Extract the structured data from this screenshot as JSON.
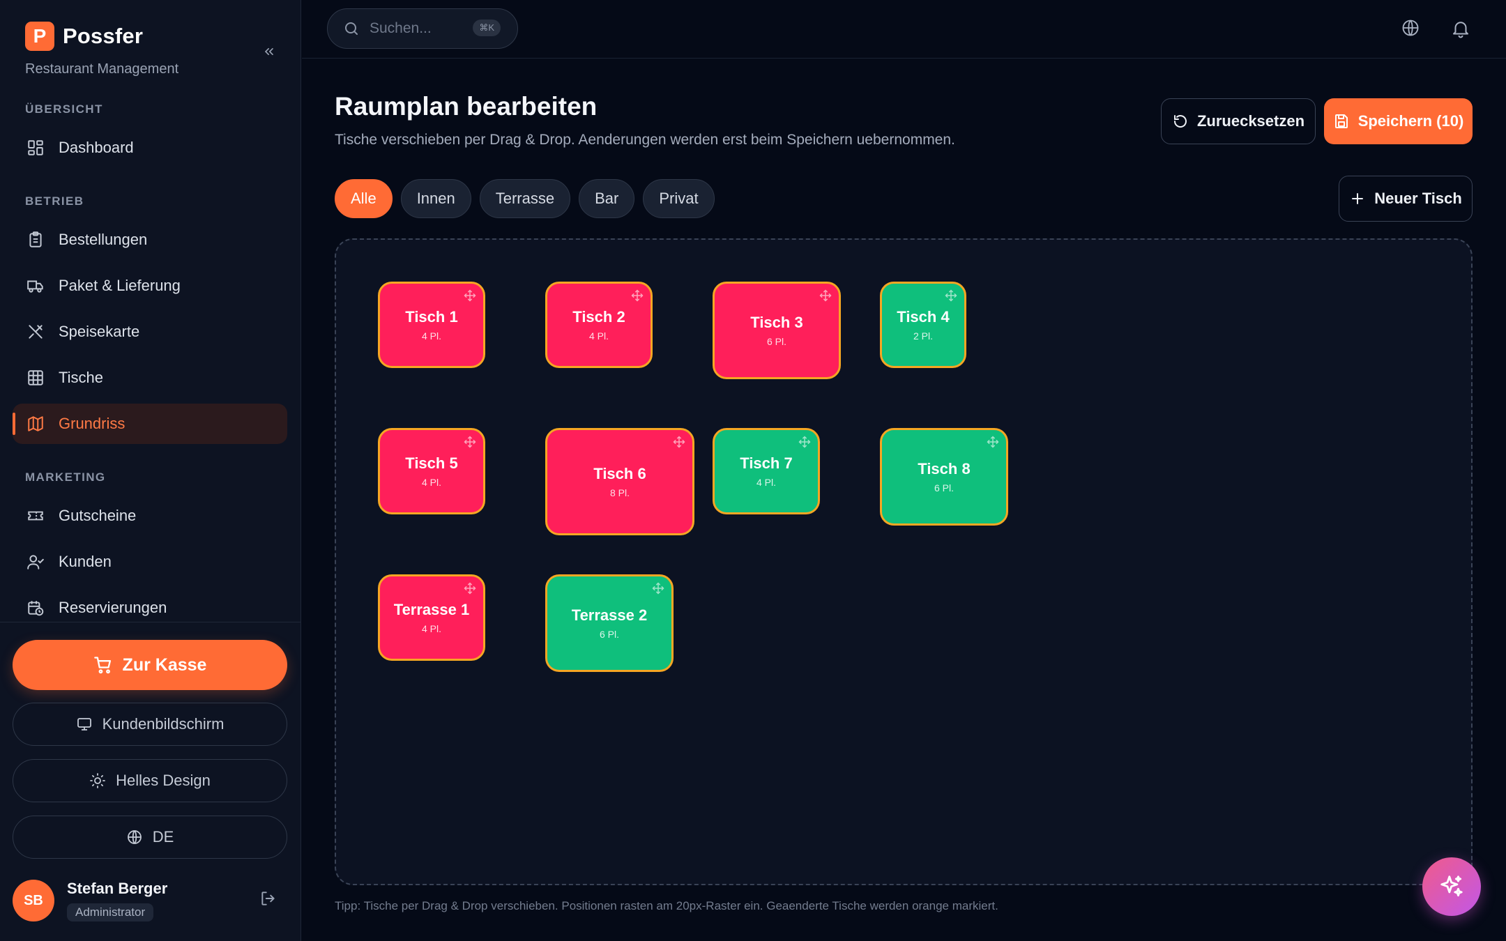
{
  "brand": {
    "logo_letter": "P",
    "name": "Possfer",
    "subtitle": "Restaurant Management"
  },
  "sidebar": {
    "sections": [
      {
        "label": "ÜBERSICHT"
      },
      {
        "label": "BETRIEB"
      },
      {
        "label": "MARKETING"
      }
    ],
    "items": [
      {
        "label": "Dashboard",
        "icon": "dashboard-icon"
      },
      {
        "label": "Bestellungen",
        "icon": "clipboard-icon"
      },
      {
        "label": "Paket & Lieferung",
        "icon": "truck-icon"
      },
      {
        "label": "Speisekarte",
        "icon": "utensils-icon"
      },
      {
        "label": "Tische",
        "icon": "grid-icon"
      },
      {
        "label": "Grundriss",
        "icon": "map-icon",
        "active": true
      },
      {
        "label": "Gutscheine",
        "icon": "ticket-icon"
      },
      {
        "label": "Kunden",
        "icon": "user-check-icon"
      },
      {
        "label": "Reservierungen",
        "icon": "calendar-clock-icon"
      }
    ],
    "kasse_label": "Zur Kasse",
    "customer_screen_label": "Kundenbildschirm",
    "theme_label": "Helles Design",
    "language_label": "DE",
    "user": {
      "initials": "SB",
      "name": "Stefan Berger",
      "role": "Administrator"
    }
  },
  "topbar": {
    "search_placeholder": "Suchen...",
    "shortcut": "⌘K"
  },
  "main": {
    "title": "Raumplan bearbeiten",
    "description": "Tische verschieben per Drag & Drop. Aenderungen werden erst beim Speichern uebernommen.",
    "reset_label": "Zuruecksetzen",
    "save_label": "Speichern (10)",
    "new_table_label": "Neuer Tisch",
    "filters": [
      "Alle",
      "Innen",
      "Terrasse",
      "Bar",
      "Privat"
    ],
    "active_filter": "Alle",
    "tables": [
      {
        "name": "Tisch 1",
        "seats": "4 Pl.",
        "status": "red"
      },
      {
        "name": "Tisch 2",
        "seats": "4 Pl.",
        "status": "red"
      },
      {
        "name": "Tisch 3",
        "seats": "6 Pl.",
        "status": "red"
      },
      {
        "name": "Tisch 4",
        "seats": "2 Pl.",
        "status": "green"
      },
      {
        "name": "Tisch 5",
        "seats": "4 Pl.",
        "status": "red"
      },
      {
        "name": "Tisch 6",
        "seats": "8 Pl.",
        "status": "red"
      },
      {
        "name": "Tisch 7",
        "seats": "4 Pl.",
        "status": "green"
      },
      {
        "name": "Tisch 8",
        "seats": "6 Pl.",
        "status": "green"
      },
      {
        "name": "Terrasse 1",
        "seats": "4 Pl.",
        "status": "red"
      },
      {
        "name": "Terrasse 2",
        "seats": "6 Pl.",
        "status": "green"
      }
    ],
    "hint": "Tipp: Tische per Drag & Drop verschieben. Positionen rasten am 20px-Raster ein. Geaenderte Tische werden orange markiert."
  },
  "colors": {
    "accent": "#ff6b35",
    "occupied": "#ff1f5a",
    "free": "#0fbf7c",
    "modified_border": "#f5a623"
  }
}
